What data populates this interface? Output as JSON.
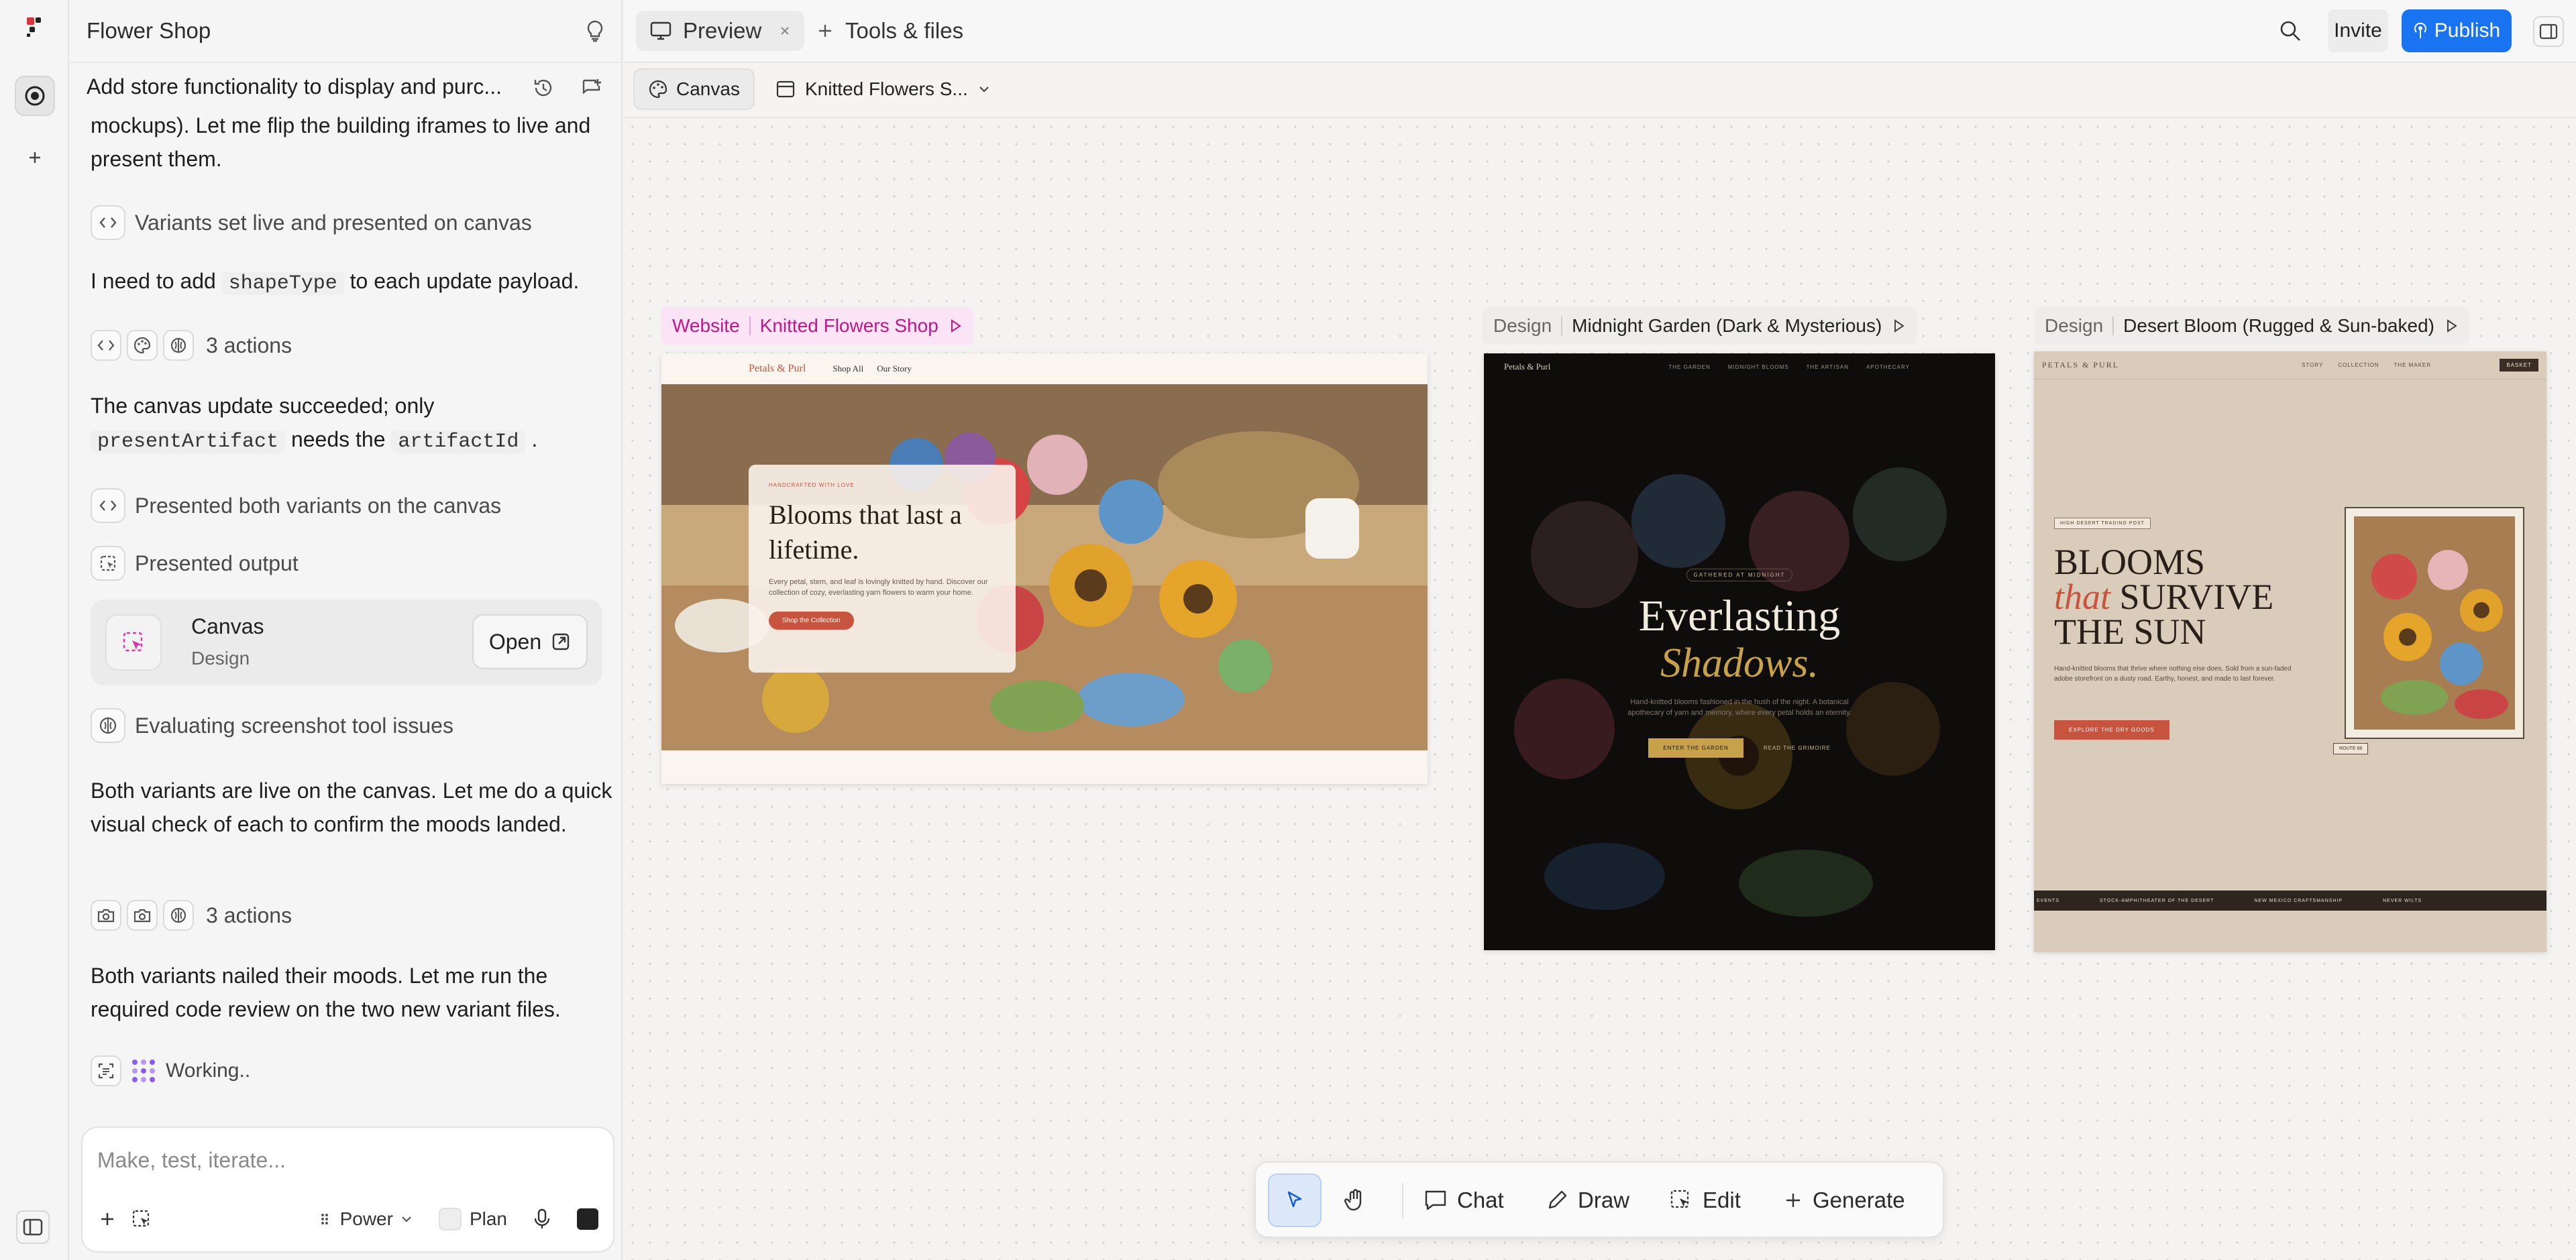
{
  "project": {
    "name": "Flower Shop"
  },
  "chat": {
    "task_title": "Add store functionality to display and purc...",
    "messages": [
      "mockups). Let me flip the building iframes to live and present them.",
      "I need to add",
      "to each update payload.",
      "The canvas update succeeded; only",
      "needs the",
      "Both variants are live on the canvas. Let me do a quick visual check of each to confirm the moods landed.",
      "Both variants nailed their moods. Let me run the required code review on the two new variant files."
    ],
    "code_terms": [
      "shapeType",
      "presentArtifact",
      "artifactId"
    ],
    "steps": {
      "variants_live": "Variants set live and presented on canvas",
      "actions_1": "3 actions",
      "presented_both": "Presented both variants on the canvas",
      "presented_output": "Presented output",
      "evaluating": "Evaluating screenshot tool issues",
      "actions_2": "3 actions",
      "working": "Working.."
    },
    "artifact_card": {
      "title": "Canvas",
      "subtitle": "Design",
      "open_label": "Open"
    },
    "input": {
      "placeholder": "Make, test, iterate...",
      "mode": "Power",
      "plan": "Plan"
    }
  },
  "topbar": {
    "preview_tab": "Preview",
    "tools_tab": "Tools & files",
    "invite": "Invite",
    "publish": "Publish"
  },
  "subbar": {
    "canvas_btn": "Canvas",
    "file_name": "Knitted Flowers S..."
  },
  "frames": [
    {
      "kind": "Website",
      "name": "Knitted Flowers Shop",
      "site": {
        "brand": "Petals & Purl",
        "nav": [
          "Shop All",
          "Our Story"
        ],
        "eyebrow": "HANDCRAFTED WITH LOVE",
        "headline": "Blooms that last a lifetime.",
        "body": "Every petal, stem, and leaf is lovingly knitted by hand. Discover our collection of cozy, everlasting yarn flowers to warm your home.",
        "cta": "Shop the Collection"
      }
    },
    {
      "kind": "Design",
      "name": "Midnight Garden (Dark & Mysterious)",
      "site": {
        "brand": "Petals & Purl",
        "nav": [
          "THE GARDEN",
          "MIDNIGHT BLOOMS",
          "THE ARTISAN",
          "APOTHECARY"
        ],
        "eyebrow": "GATHERED AT MIDNIGHT",
        "headline_1": "Everlasting",
        "headline_2": "Shadows.",
        "body": "Hand-knitted blooms fashioned in the hush of the night. A botanical apothecary of yarn and memory, where every petal holds an eternity.",
        "cta": "ENTER THE GARDEN",
        "cta_2": "READ THE GRIMOIRE"
      }
    },
    {
      "kind": "Design",
      "name": "Desert Bloom (Rugged & Sun-baked)",
      "site": {
        "brand": "PETALS & PURL",
        "nav": [
          "STORY",
          "COLLECTION",
          "THE MAKER"
        ],
        "cart": "BASKET",
        "badge": "HIGH DESERT TRADING POST",
        "headline_1": "BLOOMS",
        "headline_2a": "that",
        "headline_2b": "SURVIVE",
        "headline_3": "THE SUN",
        "body": "Hand-knitted blooms that thrive where nothing else does. Sold from a sun-faded adobe storefront on a dusty road. Earthy, honest, and made to last forever.",
        "cta": "EXPLORE THE DRY GOODS",
        "tag": "ROUTE 66",
        "ticker": [
          "EVENTS",
          "STOCK-AMPHITHEATER OF THE DESERT",
          "NEW MEXICO CRAFTSMANSHIP",
          "NEVER WILTS"
        ]
      }
    }
  ],
  "toolbar": {
    "chat": "Chat",
    "draw": "Draw",
    "edit": "Edit",
    "generate": "Generate"
  },
  "colors": {
    "publish": "#1a73f0",
    "website_label": "#fbe4f5",
    "website_label_text": "#c0168a",
    "terracotta": "#c7543e",
    "gold": "#c8a24a"
  }
}
